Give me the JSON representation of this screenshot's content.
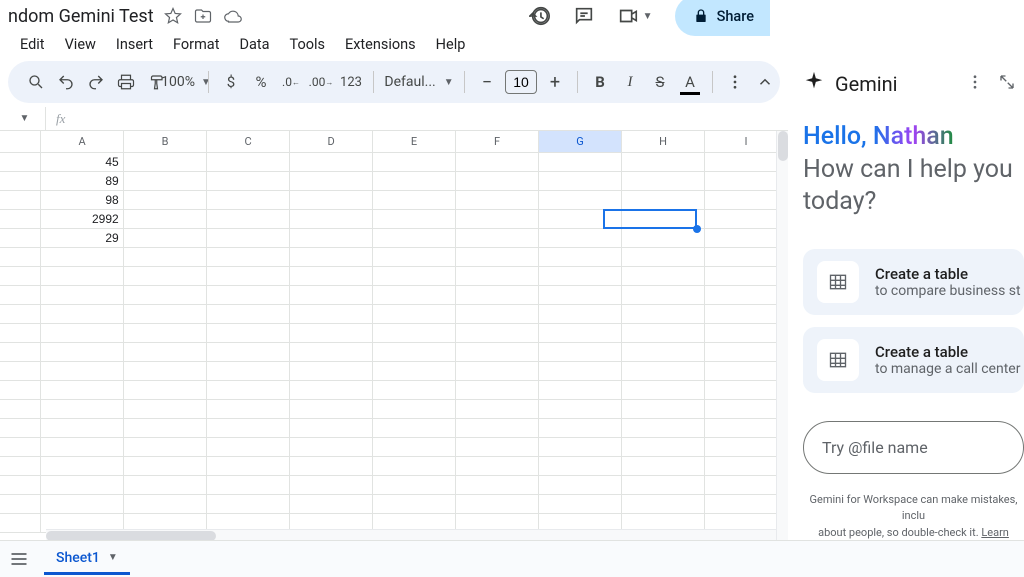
{
  "doc": {
    "title": "ndom Gemini Test"
  },
  "menus": [
    "Edit",
    "View",
    "Insert",
    "Format",
    "Data",
    "Tools",
    "Extensions",
    "Help"
  ],
  "toolbar": {
    "zoom": "100%",
    "font": "Defaul...",
    "size": "10"
  },
  "share": {
    "label": "Share"
  },
  "namebox": "",
  "columns": [
    "A",
    "B",
    "C",
    "D",
    "E",
    "F",
    "G",
    "H",
    "I"
  ],
  "selectedColIndex": 6,
  "dataCells": {
    "1": "45",
    "2": "89",
    "3": "98",
    "4": "2992",
    "5": "29"
  },
  "rowCount": 20,
  "tabs": {
    "sheet1": "Sheet1"
  },
  "gemini": {
    "title": "Gemini",
    "hello": "Hello, ",
    "name": "Nathan",
    "subtitle": "How can I help you today?",
    "cards": [
      {
        "title": "Create a table",
        "sub": "to compare business st"
      },
      {
        "title": "Create a table",
        "sub": "to manage a call center"
      }
    ],
    "prompt_placeholder": "Try @file name",
    "disclaimer1": "Gemini for Workspace can make mistakes, inclu",
    "disclaimer2": "about people, so double-check it. ",
    "learn": "Learn mor"
  }
}
